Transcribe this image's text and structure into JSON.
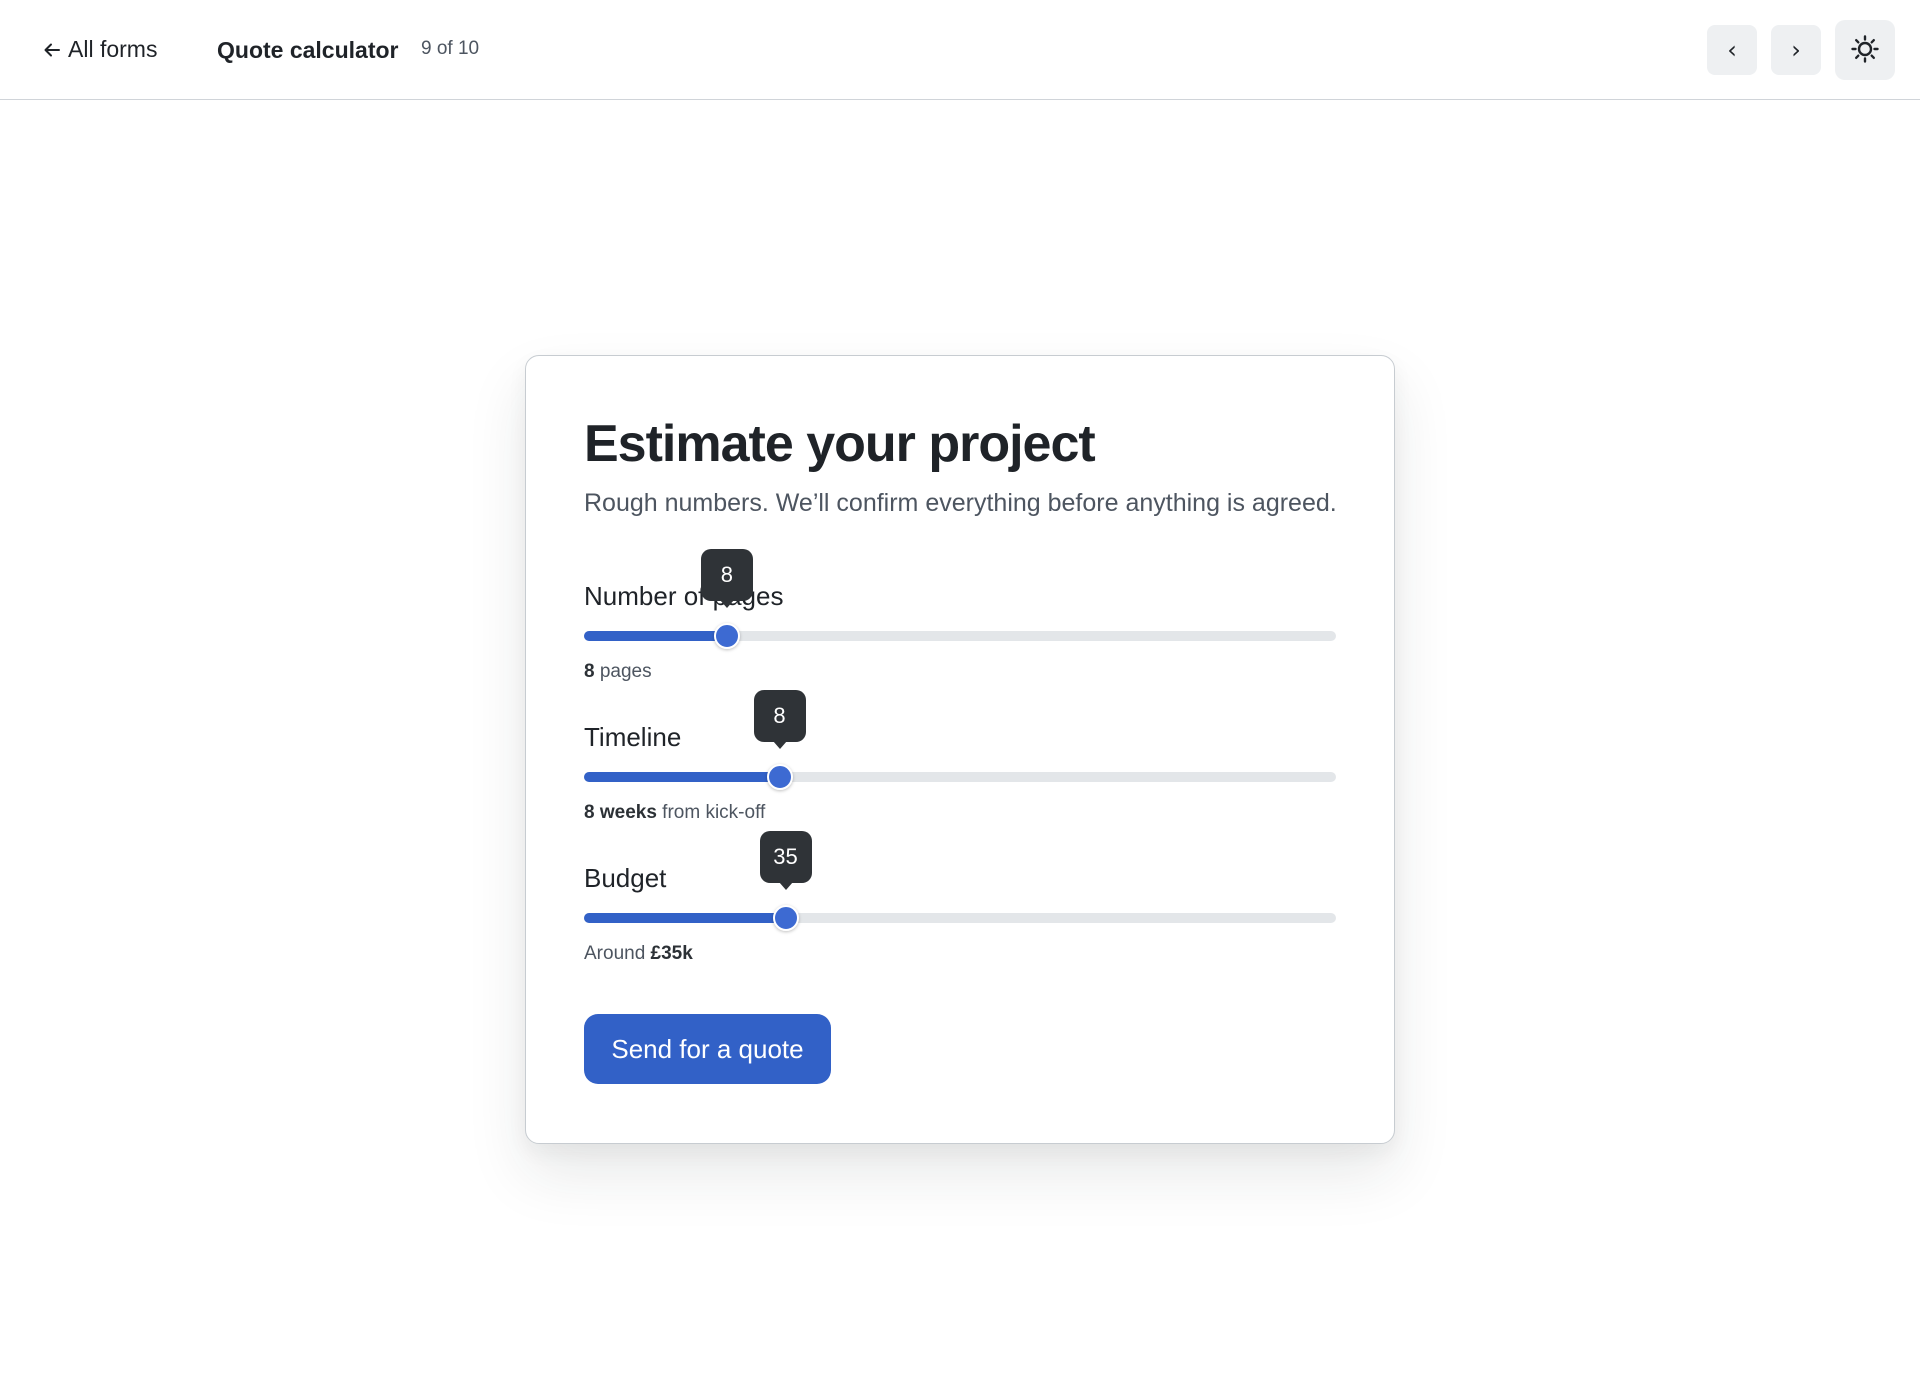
{
  "header": {
    "back_label": "All forms",
    "title": "Quote calculator",
    "counter": "9 of 10",
    "prev_label": "‹",
    "next_label": "›",
    "theme_icon": "sun-icon"
  },
  "form": {
    "title": "Estimate your project",
    "subtitle": "Rough numbers. We’ll confirm everything before anything is agreed.",
    "sliders": [
      {
        "label": "Number of pages",
        "value": 8,
        "fraction": 0.19,
        "bubble": "8",
        "hint_prefix": "",
        "hint_bold": "8",
        "hint_suffix": " pages"
      },
      {
        "label": "Timeline",
        "value": 8,
        "fraction": 0.26,
        "bubble": "8",
        "hint_prefix": "",
        "hint_bold": "8 weeks",
        "hint_suffix": " from kick-off"
      },
      {
        "label": "Budget",
        "value": 35,
        "fraction": 0.268,
        "bubble": "35",
        "hint_prefix": "Around ",
        "hint_bold": "£35k",
        "hint_suffix": ""
      }
    ],
    "submit_label": "Send for a quote"
  },
  "colors": {
    "accent": "#3261c7",
    "tooltip_bg": "#2f3337",
    "track": "#e3e6e9"
  }
}
